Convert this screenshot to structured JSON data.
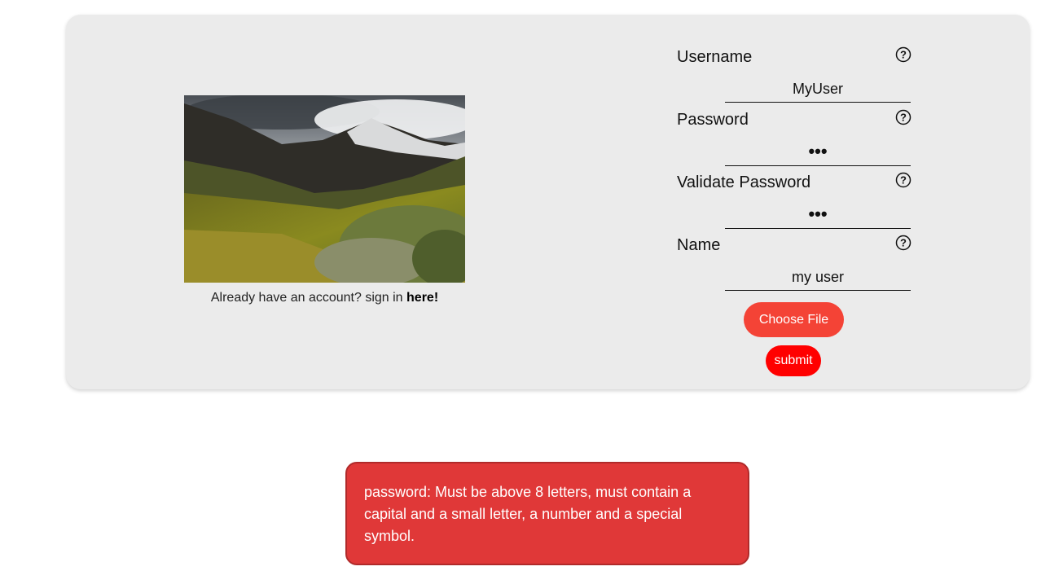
{
  "signin": {
    "prefix": "Already have an account? sign in ",
    "link": "here!"
  },
  "form": {
    "fields": [
      {
        "label": "Username",
        "value": "MyUser",
        "type": "text"
      },
      {
        "label": "Password",
        "value": "•••",
        "type": "password"
      },
      {
        "label": "Validate Password",
        "value": "•••",
        "type": "password"
      },
      {
        "label": "Name",
        "value": "my user",
        "type": "text"
      }
    ],
    "choose_file_label": "Choose File",
    "submit_label": "submit",
    "help_icon": "question-circle-icon"
  },
  "error": {
    "message": "password: Must be above 8 letters, must contain a capital and a small letter, a number and a special symbol."
  },
  "colors": {
    "card_bg": "#ebebeb",
    "choose_file_bg": "#f44336",
    "submit_bg": "#ff0000",
    "error_bg": "#e03838"
  }
}
